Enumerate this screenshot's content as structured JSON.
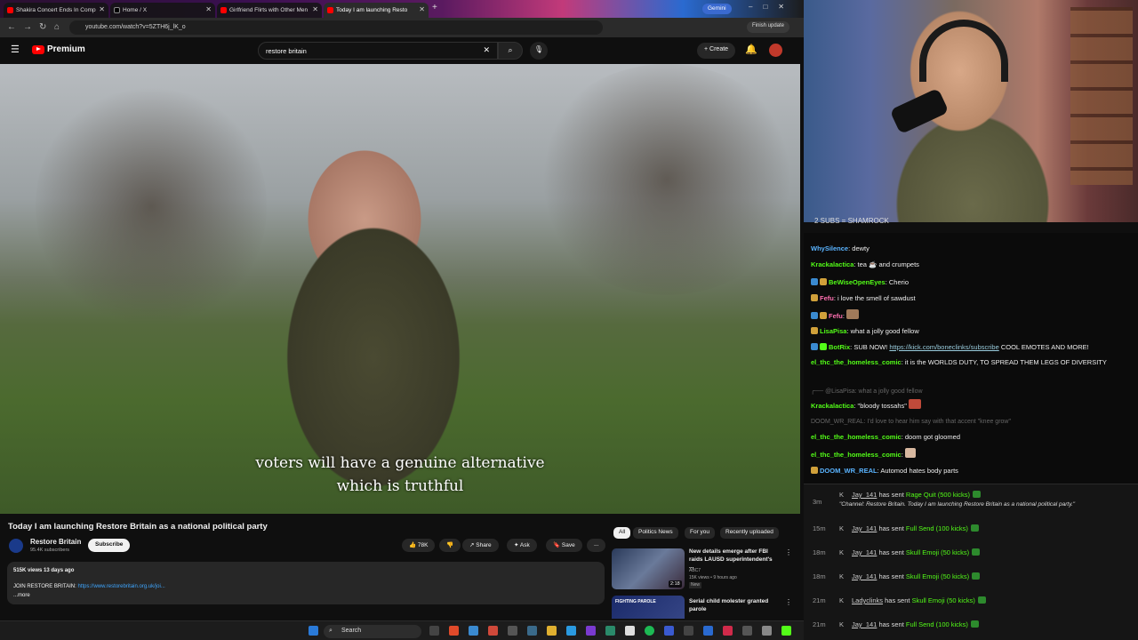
{
  "browser": {
    "tabs": [
      {
        "label": "Shakira Concert Ends In Comp"
      },
      {
        "label": "Home / X"
      },
      {
        "label": "Girlfriend Flirts with Other Men"
      },
      {
        "label": "Today I am launching Resto"
      }
    ],
    "new_tab": "+",
    "gemini_label": "Gemini",
    "url": "youtube.com/watch?v=5ZTH6j_lK_o",
    "finish_update": "Finish update"
  },
  "youtube": {
    "logo_text": "Premium",
    "search_value": "restore britain",
    "create_label": "Create",
    "subtitle_line1": "voters will have a genuine alternative",
    "subtitle_line2": "which is truthful",
    "video_title": "Today I am launching Restore Britain as a national political party",
    "channel_name": "Restore Britain",
    "channel_subs": "95.4K subscribers",
    "subscribe_label": "Subscribe",
    "like_count": "78K",
    "share_label": "Share",
    "ask_label": "Ask",
    "save_label": "Save",
    "more_label": "...",
    "views_line": "515K views  13 days ago",
    "desc_text": "JOIN RESTORE BRITAIN: ",
    "desc_link": "https://www.restorebritain.org.uk/joi...",
    "desc_more": "...more",
    "chips": [
      "All",
      "Politics News",
      "For you",
      "Recently uploaded"
    ],
    "related": [
      {
        "title": "New details emerge after FBI raids LAUSD superintendent's ...",
        "channel": "ABC7",
        "meta": "15K views • 9 hours ago",
        "badge": "New",
        "duration": "2:18"
      },
      {
        "title": "Serial child molester granted parole",
        "thumb_text": "FIGHTING PAROLE",
        "meta": "",
        "duration": ""
      }
    ]
  },
  "taskbar": {
    "search_label": "Search"
  },
  "stream": {
    "banner": "2 SUBS = SHAMROCK",
    "chat": [
      {
        "user": "WhySilence",
        "text": "dewty",
        "color": "#5ab4ff"
      },
      {
        "user": "Krackalactica",
        "text": "tea ☕ and crumpets",
        "color": "#53fc18"
      },
      {
        "user": "BeWiseOpenEyes",
        "text": "Cherio",
        "color": "#53fc18"
      },
      {
        "user": "Fefu",
        "text": "i love the smell of sawdust",
        "color": "#ff6fb0"
      },
      {
        "user": "Fefu",
        "text": "",
        "color": "#ff6fb0"
      },
      {
        "user": "LisaPisa",
        "text": "what a jolly good fellow",
        "color": "#53fc18"
      },
      {
        "user": "BotRix",
        "text": "SUB NOW! ",
        "link": "https://kick.com/boneclinks/subscribe",
        "after": " COOL EMOTES AND MORE!",
        "color": "#53fc18"
      },
      {
        "user": "el_thc_the_homeless_comic",
        "text": "it is the WORLDS DUTY, TO SPREAD THEM LEGS OF DIVERSITY",
        "color": "#53fc18"
      },
      {
        "reply": "@LisaPisa: what a jolly good fellow"
      },
      {
        "user": "Krackalactica",
        "text": "\"bloody tossahs\"",
        "color": "#53fc18"
      },
      {
        "dim_user": "DOOM_WR_REAL",
        "dim_text": "I'd love to hear him say with that accent \"knee grow\""
      },
      {
        "user": "el_thc_the_homeless_comic",
        "text": "doom got gloomed",
        "color": "#53fc18"
      },
      {
        "user": "el_thc_the_homeless_comic",
        "text": "",
        "color": "#53fc18"
      },
      {
        "user": "DOOM_WR_REAL",
        "text": "Automod hates body parts",
        "color": "#5ab4ff"
      }
    ],
    "alerts": [
      {
        "time": "3m",
        "user": "Jay_141",
        "verb": "has sent",
        "item": "Rage Quit (500 kicks)",
        "quote": "\"Channel: Restore Britain. Today I am launching Restore Britain as a national political party.\""
      },
      {
        "time": "15m",
        "user": "Jay_141",
        "verb": "has sent",
        "item": "Full Send (100 kicks)"
      },
      {
        "time": "18m",
        "user": "Jay_141",
        "verb": "has sent",
        "item": "Skull Emoji (50 kicks)"
      },
      {
        "time": "18m",
        "user": "Jay_141",
        "verb": "has sent",
        "item": "Skull Emoji (50 kicks)"
      },
      {
        "time": "21m",
        "user": "Ladyclinks",
        "verb": "has sent",
        "item": "Skull Emoji (50 kicks)"
      },
      {
        "time": "21m",
        "user": "Jay_141",
        "verb": "has sent",
        "item": "Full Send (100 kicks)"
      }
    ]
  }
}
